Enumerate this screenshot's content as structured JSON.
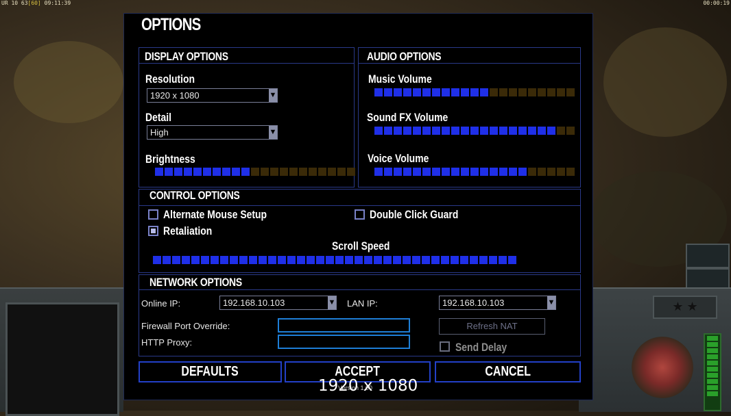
{
  "topbar": {
    "left_prefix": "UR 10 63",
    "left_fps": "[60]",
    "left_time": "09:11:39",
    "right_time": "00:00:19"
  },
  "title": "OPTIONS",
  "display": {
    "header": "DISPLAY OPTIONS",
    "resolution_label": "Resolution",
    "resolution_value": "1920 x 1080",
    "detail_label": "Detail",
    "detail_value": "High",
    "brightness_label": "Brightness",
    "brightness_level": {
      "on": 10,
      "total": 21
    }
  },
  "audio": {
    "header": "AUDIO OPTIONS",
    "music_label": "Music Volume",
    "music_level": {
      "on": 12,
      "total": 21
    },
    "sfx_label": "Sound FX Volume",
    "sfx_level": {
      "on": 19,
      "total": 21
    },
    "voice_label": "Voice Volume",
    "voice_level": {
      "on": 16,
      "total": 21
    }
  },
  "control": {
    "header": "CONTROL OPTIONS",
    "alt_mouse_label": "Alternate Mouse Setup",
    "alt_mouse_checked": false,
    "retaliation_label": "Retaliation",
    "retaliation_checked": true,
    "double_click_label": "Double Click Guard",
    "double_click_checked": false,
    "scroll_label": "Scroll Speed",
    "scroll_level": {
      "on": 38,
      "total": 38
    }
  },
  "network": {
    "header": "NETWORK OPTIONS",
    "online_ip_label": "Online IP:",
    "online_ip_value": "192.168.10.103",
    "lan_ip_label": "LAN IP:",
    "lan_ip_value": "192.168.10.103",
    "firewall_label": "Firewall Port Override:",
    "firewall_value": "",
    "proxy_label": "HTTP Proxy:",
    "proxy_value": "",
    "refresh_nat_label": "Refresh NAT",
    "send_delay_label": "Send Delay",
    "send_delay_checked": false
  },
  "buttons": {
    "defaults": "DEFAULTS",
    "accept": "ACCEPT",
    "cancel": "CANCEL"
  },
  "version": "Version 1.00",
  "resolution_overlay": "1920 x 1080",
  "colors": {
    "slider_on": "#1f2fe8",
    "slider_off": "#3a2a08",
    "frame": "#2a3a8a",
    "input_border": "#1e7fd8"
  }
}
